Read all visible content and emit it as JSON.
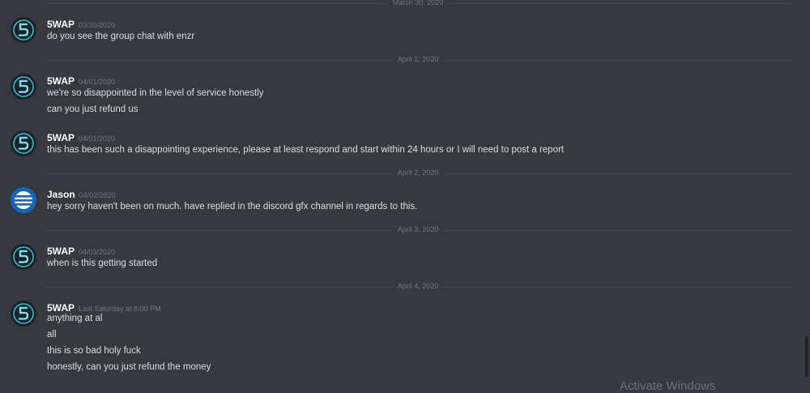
{
  "dividers": [
    "March 30, 2020",
    "April 1, 2020",
    "April 2, 2020",
    "April 3, 2020",
    "April 4, 2020"
  ],
  "messages": [
    {
      "author": "5WAP",
      "timestamp": "03/30/2020",
      "avatar": "5wap-logo-avatar",
      "lines": [
        "do you see the group chat with enzr"
      ]
    },
    {
      "author": "5WAP",
      "timestamp": "04/01/2020",
      "avatar": "5wap-logo-avatar",
      "lines": [
        "we're so disappointed in the level of service honestly",
        "can you just refund us"
      ]
    },
    {
      "author": "5WAP",
      "timestamp": "04/01/2020",
      "avatar": "5wap-logo-avatar",
      "lines": [
        "this has been such a disappointing experience, please at least respond and start within 24 hours or I will need to post a report"
      ]
    },
    {
      "author": "Jason",
      "timestamp": "04/02/2020",
      "avatar": "striped-globe-avatar",
      "lines": [
        "hey sorry haven't been on much. have replied in the discord gfx channel in regards to this."
      ]
    },
    {
      "author": "5WAP",
      "timestamp": "04/03/2020",
      "avatar": "5wap-logo-avatar",
      "lines": [
        "when is this getting started"
      ]
    },
    {
      "author": "5WAP",
      "timestamp": "Last Saturday at 8:00 PM",
      "avatar": "5wap-logo-avatar",
      "lines": [
        "anything at al",
        "all",
        "this is so bad holy fuck",
        "honestly, can you just refund the money"
      ]
    }
  ],
  "overlay": {
    "watermark": "Activate Windows"
  },
  "colors": {
    "background": "#36393f",
    "username": "#ffffff",
    "message_text": "#dcddde",
    "muted": "#72767d",
    "jason_avatar": "#1565c0",
    "wap_avatar_accent": "#2ec4d6"
  }
}
